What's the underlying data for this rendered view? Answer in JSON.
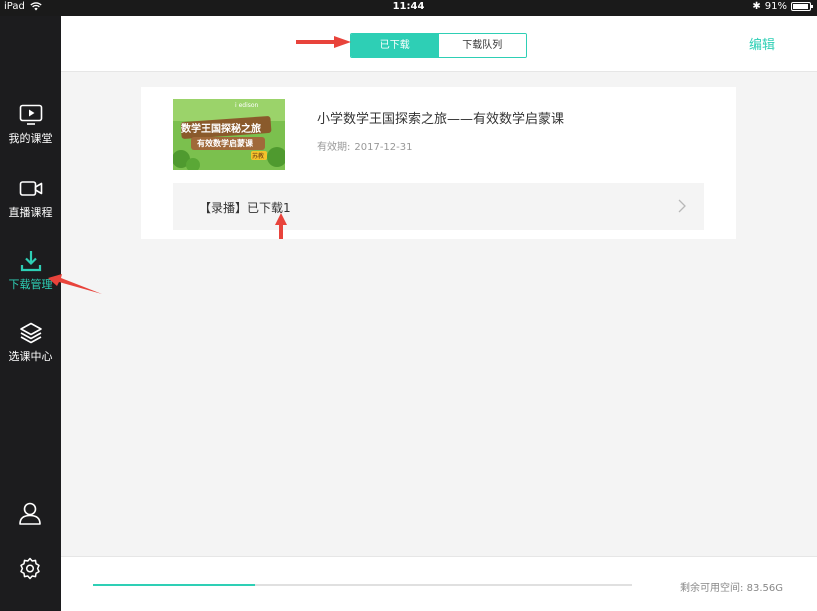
{
  "status_bar": {
    "device": "iPad",
    "time": "11:44",
    "battery": "91%",
    "battery_level": 0.91
  },
  "sidebar": {
    "items": [
      {
        "label": "我的课堂",
        "icon": "video-play-icon"
      },
      {
        "label": "直播课程",
        "icon": "video-camera-icon"
      },
      {
        "label": "下载管理",
        "icon": "download-icon"
      },
      {
        "label": "选课中心",
        "icon": "layers-icon"
      }
    ],
    "bottom": [
      {
        "icon": "user-icon"
      },
      {
        "icon": "settings-icon"
      }
    ]
  },
  "header": {
    "tabs": [
      {
        "label": "已下载",
        "active": true
      },
      {
        "label": "下载队列",
        "active": false
      }
    ],
    "edit_label": "编辑"
  },
  "course": {
    "title": "小学数学王国探索之旅——有效数学启蒙课",
    "validity_label": "有效期:",
    "validity_date": "2017-12-31",
    "thumbnail": {
      "line1": "数学王国探秘之旅",
      "line2": "有效数学启蒙课",
      "brand": "i edison",
      "badge": "苏教"
    },
    "entry_label": "【录播】已下载1"
  },
  "footer": {
    "progress": 0.3,
    "storage_label": "剩余可用空间:",
    "storage_value": "83.56G"
  },
  "colors": {
    "accent": "#2ecfb5",
    "sidebar": "#1c1c1e",
    "annotation": "#e8433b"
  }
}
